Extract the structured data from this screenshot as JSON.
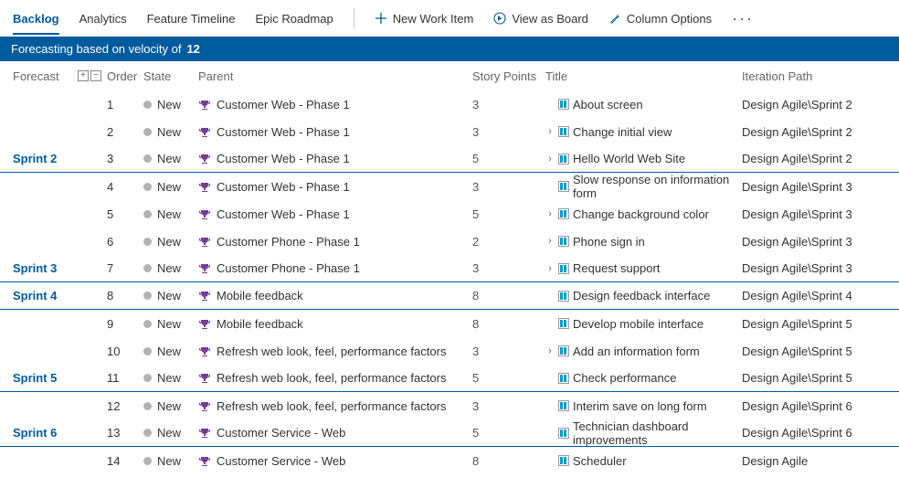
{
  "toolbar": {
    "tabs": [
      "Backlog",
      "Analytics",
      "Feature Timeline",
      "Epic Roadmap"
    ],
    "active_tab_index": 0,
    "commands": {
      "new_item": "New Work Item",
      "view_board": "View as Board",
      "column_options": "Column Options"
    }
  },
  "forecast_bar": {
    "prefix": "Forecasting based on velocity of",
    "velocity": "12"
  },
  "columns": {
    "forecast": "Forecast",
    "order": "Order",
    "state": "State",
    "parent": "Parent",
    "story_points": "Story Points",
    "title": "Title",
    "iteration_path": "Iteration Path"
  },
  "rows": [
    {
      "forecast": "",
      "order": "1",
      "state": "New",
      "parent": "Customer Web - Phase 1",
      "points": "3",
      "has_children": false,
      "title": "About screen",
      "iter": "Design Agile\\Sprint 2",
      "break": false
    },
    {
      "forecast": "",
      "order": "2",
      "state": "New",
      "parent": "Customer Web - Phase 1",
      "points": "3",
      "has_children": true,
      "title": "Change initial view",
      "iter": "Design Agile\\Sprint 2",
      "break": false
    },
    {
      "forecast": "Sprint 2",
      "order": "3",
      "state": "New",
      "parent": "Customer Web - Phase 1",
      "points": "5",
      "has_children": true,
      "title": "Hello World Web Site",
      "iter": "Design Agile\\Sprint 2",
      "break": true
    },
    {
      "forecast": "",
      "order": "4",
      "state": "New",
      "parent": "Customer Web - Phase 1",
      "points": "3",
      "has_children": false,
      "title": "Slow response on information form",
      "iter": "Design Agile\\Sprint 3",
      "break": false
    },
    {
      "forecast": "",
      "order": "5",
      "state": "New",
      "parent": "Customer Web - Phase 1",
      "points": "5",
      "has_children": true,
      "title": "Change background color",
      "iter": "Design Agile\\Sprint 3",
      "break": false
    },
    {
      "forecast": "",
      "order": "6",
      "state": "New",
      "parent": "Customer Phone - Phase 1",
      "points": "2",
      "has_children": true,
      "title": "Phone sign in",
      "iter": "Design Agile\\Sprint 3",
      "break": false
    },
    {
      "forecast": "Sprint 3",
      "order": "7",
      "state": "New",
      "parent": "Customer Phone - Phase 1",
      "points": "3",
      "has_children": true,
      "title": "Request support",
      "iter": "Design Agile\\Sprint 3",
      "break": true
    },
    {
      "forecast": "Sprint 4",
      "order": "8",
      "state": "New",
      "parent": "Mobile feedback",
      "points": "8",
      "has_children": false,
      "title": "Design feedback interface",
      "iter": "Design Agile\\Sprint 4",
      "break": true
    },
    {
      "forecast": "",
      "order": "9",
      "state": "New",
      "parent": "Mobile feedback",
      "points": "8",
      "has_children": false,
      "title": "Develop mobile interface",
      "iter": "Design Agile\\Sprint 5",
      "break": false
    },
    {
      "forecast": "",
      "order": "10",
      "state": "New",
      "parent": "Refresh web look, feel, performance factors",
      "points": "3",
      "has_children": true,
      "title": "Add an information form",
      "iter": "Design Agile\\Sprint 5",
      "break": false
    },
    {
      "forecast": "Sprint 5",
      "order": "11",
      "state": "New",
      "parent": "Refresh web look, feel, performance factors",
      "points": "5",
      "has_children": false,
      "title": "Check performance",
      "iter": "Design Agile\\Sprint 5",
      "break": true
    },
    {
      "forecast": "",
      "order": "12",
      "state": "New",
      "parent": "Refresh web look, feel, performance factors",
      "points": "3",
      "has_children": false,
      "title": "Interim save on long form",
      "iter": "Design Agile\\Sprint 6",
      "break": false
    },
    {
      "forecast": "Sprint 6",
      "order": "13",
      "state": "New",
      "parent": "Customer Service - Web",
      "points": "5",
      "has_children": false,
      "title": "Technician dashboard improvements",
      "iter": "Design Agile\\Sprint 6",
      "break": true
    },
    {
      "forecast": "",
      "order": "14",
      "state": "New",
      "parent": "Customer Service - Web",
      "points": "8",
      "has_children": false,
      "title": "Scheduler",
      "iter": "Design Agile",
      "break": false
    }
  ]
}
